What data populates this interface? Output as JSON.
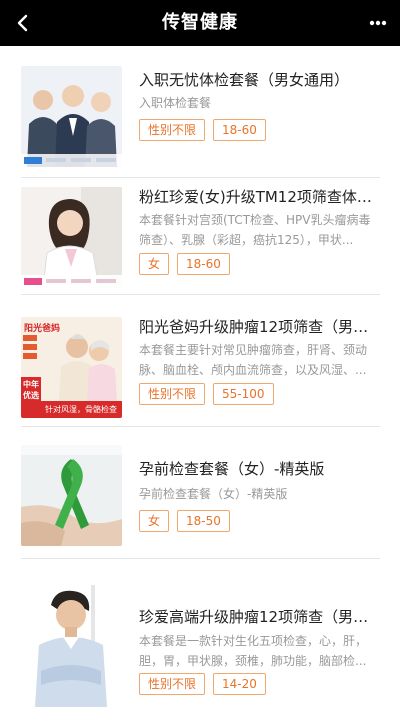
{
  "header": {
    "title": "传智健康",
    "back_icon": "back-arrow-icon",
    "more_icon": "more-dots-icon"
  },
  "colors": {
    "header_bg": "#000000",
    "tag_border": "#f0a86e",
    "tag_text": "#e8732b",
    "title_text": "#222222",
    "desc_text": "#999999"
  },
  "packages": [
    {
      "title": "入职无忧体检套餐（男女通用）",
      "desc": "入职体检套餐",
      "tags": [
        "性别不限",
        "18-60"
      ],
      "image": "office-staff-photo"
    },
    {
      "title": "粉红珍爱(女)升级TM12项筛查体检...",
      "desc": "本套餐针对宫颈(TCT检查、HPV乳头瘤病毒筛查）、乳腺（彩超，癌抗125），甲状...",
      "tags": [
        "女",
        "18-60"
      ],
      "image": "woman-doctor-photo"
    },
    {
      "title": "阳光爸妈升级肿瘤12项筛查（男女...",
      "desc": "本套餐主要针对常见肿瘤筛查，肝肾、颈动脉、脑血栓、颅内血流筛查，以及风湿、...",
      "tags": [
        "性别不限",
        "55-100"
      ],
      "image": "elderly-couple-photo",
      "image_text": {
        "brand": "阳光爸妈",
        "badge_top": "中年",
        "badge_bottom": "优选",
        "ribbon": "针对风湿，骨骼检查"
      }
    },
    {
      "title": "孕前检查套餐（女）-精英版",
      "desc": "孕前检查套餐（女）-精英版",
      "tags": [
        "女",
        "18-50"
      ],
      "image": "green-ribbon-photo"
    },
    {
      "title": "珍爱高端升级肿瘤12项筛查（男女...",
      "desc": "本套餐是一款针对生化五项检查，心，肝，胆，胃，甲状腺，颈椎，肺功能，脑部检...",
      "tags": [
        "性别不限",
        "14-20"
      ],
      "image": "man-portrait-photo"
    }
  ]
}
